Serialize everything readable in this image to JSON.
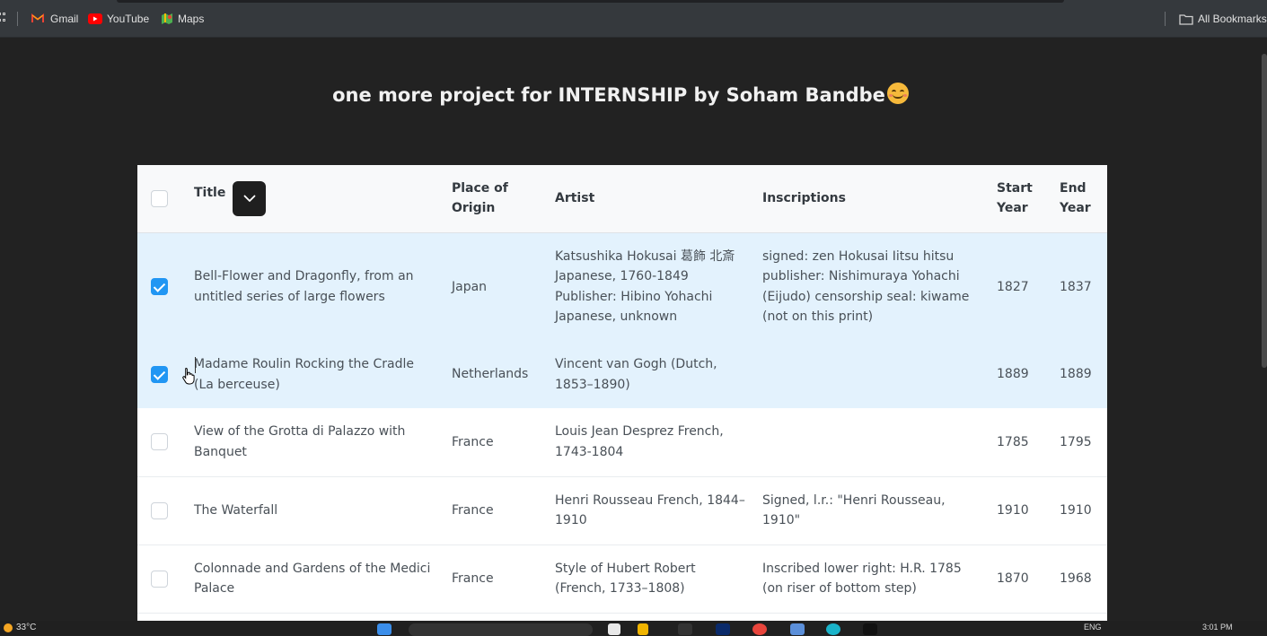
{
  "bookmarks": {
    "items": [
      {
        "label": "Gmail",
        "icon": "gmail-icon"
      },
      {
        "label": "YouTube",
        "icon": "youtube-icon"
      },
      {
        "label": "Maps",
        "icon": "maps-icon"
      }
    ],
    "all_bookmarks_label": "All Bookmarks"
  },
  "page": {
    "title": "one more project for INTERNSHIP by Soham Bandbe"
  },
  "table": {
    "columns": {
      "title": "Title",
      "origin": "Place of Origin",
      "artist": "Artist",
      "inscriptions": "Inscriptions",
      "start_year": "Start Year",
      "end_year": "End Year"
    },
    "rows": [
      {
        "selected": true,
        "title": "Bell-Flower and Dragonfly, from an untitled series of large flowers",
        "origin": "Japan",
        "artist": "Katsushika Hokusai 葛飾 北斎 Japanese, 1760-1849 Publisher: Hibino Yohachi Japanese, unknown",
        "inscriptions": "signed: zen Hokusai Iitsu hitsu publisher: Nishimuraya Yohachi (Eijudo) censorship seal: kiwame (not on this print)",
        "start_year": "1827",
        "end_year": "1837"
      },
      {
        "selected": true,
        "title": "Madame Roulin Rocking the Cradle (La berceuse)",
        "origin": "Netherlands",
        "artist": "Vincent van Gogh (Dutch, 1853–1890)",
        "inscriptions": "",
        "start_year": "1889",
        "end_year": "1889"
      },
      {
        "selected": false,
        "title": "View of the Grotta di Palazzo with Banquet",
        "origin": "France",
        "artist": "Louis Jean Desprez French, 1743-1804",
        "inscriptions": "",
        "start_year": "1785",
        "end_year": "1795"
      },
      {
        "selected": false,
        "title": "The Waterfall",
        "origin": "France",
        "artist": "Henri Rousseau French, 1844–1910",
        "inscriptions": "Signed, l.r.: \"Henri Rousseau, 1910\"",
        "start_year": "1910",
        "end_year": "1910"
      },
      {
        "selected": false,
        "title": "Colonnade and Gardens of the Medici Palace",
        "origin": "France",
        "artist": "Style of Hubert Robert (French, 1733–1808)",
        "inscriptions": "Inscribed lower right: H.R. 1785 (on riser of bottom step)",
        "start_year": "1870",
        "end_year": "1968"
      }
    ]
  },
  "taskbar": {
    "temperature": "33°C",
    "language": "ENG",
    "time": "3:01 PM"
  },
  "colors": {
    "background": "#222222",
    "selected_row": "#e3f2fd",
    "checkbox_checked": "#2196f3"
  }
}
